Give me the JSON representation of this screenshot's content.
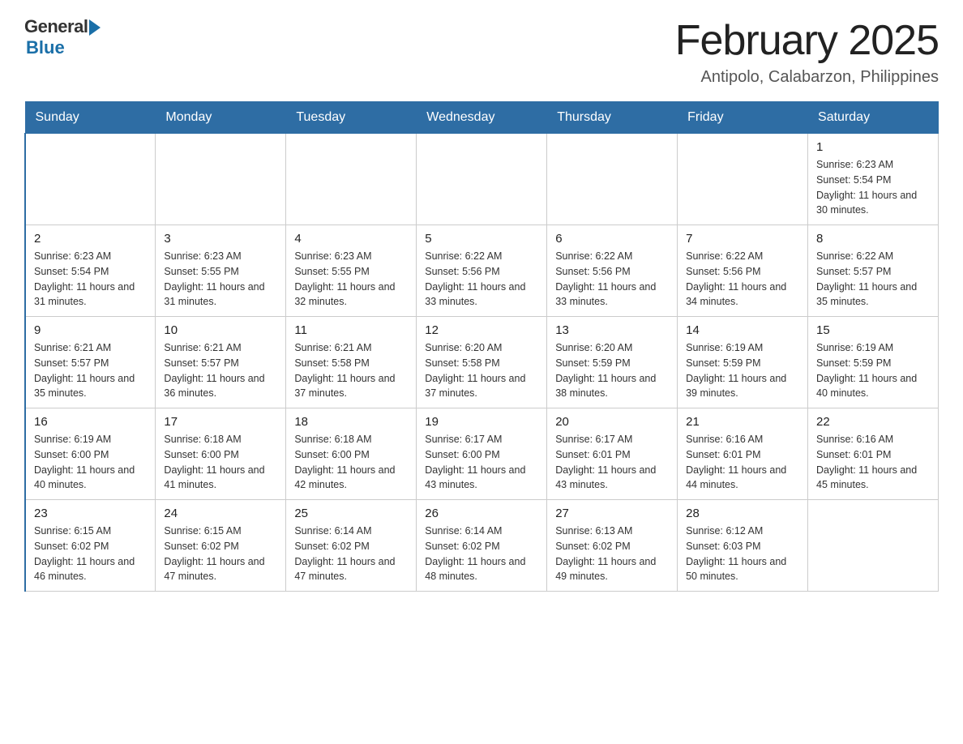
{
  "header": {
    "logo_general": "General",
    "logo_blue": "Blue",
    "title": "February 2025",
    "subtitle": "Antipolo, Calabarzon, Philippines"
  },
  "calendar": {
    "days_of_week": [
      "Sunday",
      "Monday",
      "Tuesday",
      "Wednesday",
      "Thursday",
      "Friday",
      "Saturday"
    ],
    "weeks": [
      [
        {
          "day": "",
          "info": ""
        },
        {
          "day": "",
          "info": ""
        },
        {
          "day": "",
          "info": ""
        },
        {
          "day": "",
          "info": ""
        },
        {
          "day": "",
          "info": ""
        },
        {
          "day": "",
          "info": ""
        },
        {
          "day": "1",
          "info": "Sunrise: 6:23 AM\nSunset: 5:54 PM\nDaylight: 11 hours and 30 minutes."
        }
      ],
      [
        {
          "day": "2",
          "info": "Sunrise: 6:23 AM\nSunset: 5:54 PM\nDaylight: 11 hours and 31 minutes."
        },
        {
          "day": "3",
          "info": "Sunrise: 6:23 AM\nSunset: 5:55 PM\nDaylight: 11 hours and 31 minutes."
        },
        {
          "day": "4",
          "info": "Sunrise: 6:23 AM\nSunset: 5:55 PM\nDaylight: 11 hours and 32 minutes."
        },
        {
          "day": "5",
          "info": "Sunrise: 6:22 AM\nSunset: 5:56 PM\nDaylight: 11 hours and 33 minutes."
        },
        {
          "day": "6",
          "info": "Sunrise: 6:22 AM\nSunset: 5:56 PM\nDaylight: 11 hours and 33 minutes."
        },
        {
          "day": "7",
          "info": "Sunrise: 6:22 AM\nSunset: 5:56 PM\nDaylight: 11 hours and 34 minutes."
        },
        {
          "day": "8",
          "info": "Sunrise: 6:22 AM\nSunset: 5:57 PM\nDaylight: 11 hours and 35 minutes."
        }
      ],
      [
        {
          "day": "9",
          "info": "Sunrise: 6:21 AM\nSunset: 5:57 PM\nDaylight: 11 hours and 35 minutes."
        },
        {
          "day": "10",
          "info": "Sunrise: 6:21 AM\nSunset: 5:57 PM\nDaylight: 11 hours and 36 minutes."
        },
        {
          "day": "11",
          "info": "Sunrise: 6:21 AM\nSunset: 5:58 PM\nDaylight: 11 hours and 37 minutes."
        },
        {
          "day": "12",
          "info": "Sunrise: 6:20 AM\nSunset: 5:58 PM\nDaylight: 11 hours and 37 minutes."
        },
        {
          "day": "13",
          "info": "Sunrise: 6:20 AM\nSunset: 5:59 PM\nDaylight: 11 hours and 38 minutes."
        },
        {
          "day": "14",
          "info": "Sunrise: 6:19 AM\nSunset: 5:59 PM\nDaylight: 11 hours and 39 minutes."
        },
        {
          "day": "15",
          "info": "Sunrise: 6:19 AM\nSunset: 5:59 PM\nDaylight: 11 hours and 40 minutes."
        }
      ],
      [
        {
          "day": "16",
          "info": "Sunrise: 6:19 AM\nSunset: 6:00 PM\nDaylight: 11 hours and 40 minutes."
        },
        {
          "day": "17",
          "info": "Sunrise: 6:18 AM\nSunset: 6:00 PM\nDaylight: 11 hours and 41 minutes."
        },
        {
          "day": "18",
          "info": "Sunrise: 6:18 AM\nSunset: 6:00 PM\nDaylight: 11 hours and 42 minutes."
        },
        {
          "day": "19",
          "info": "Sunrise: 6:17 AM\nSunset: 6:00 PM\nDaylight: 11 hours and 43 minutes."
        },
        {
          "day": "20",
          "info": "Sunrise: 6:17 AM\nSunset: 6:01 PM\nDaylight: 11 hours and 43 minutes."
        },
        {
          "day": "21",
          "info": "Sunrise: 6:16 AM\nSunset: 6:01 PM\nDaylight: 11 hours and 44 minutes."
        },
        {
          "day": "22",
          "info": "Sunrise: 6:16 AM\nSunset: 6:01 PM\nDaylight: 11 hours and 45 minutes."
        }
      ],
      [
        {
          "day": "23",
          "info": "Sunrise: 6:15 AM\nSunset: 6:02 PM\nDaylight: 11 hours and 46 minutes."
        },
        {
          "day": "24",
          "info": "Sunrise: 6:15 AM\nSunset: 6:02 PM\nDaylight: 11 hours and 47 minutes."
        },
        {
          "day": "25",
          "info": "Sunrise: 6:14 AM\nSunset: 6:02 PM\nDaylight: 11 hours and 47 minutes."
        },
        {
          "day": "26",
          "info": "Sunrise: 6:14 AM\nSunset: 6:02 PM\nDaylight: 11 hours and 48 minutes."
        },
        {
          "day": "27",
          "info": "Sunrise: 6:13 AM\nSunset: 6:02 PM\nDaylight: 11 hours and 49 minutes."
        },
        {
          "day": "28",
          "info": "Sunrise: 6:12 AM\nSunset: 6:03 PM\nDaylight: 11 hours and 50 minutes."
        },
        {
          "day": "",
          "info": ""
        }
      ]
    ]
  }
}
